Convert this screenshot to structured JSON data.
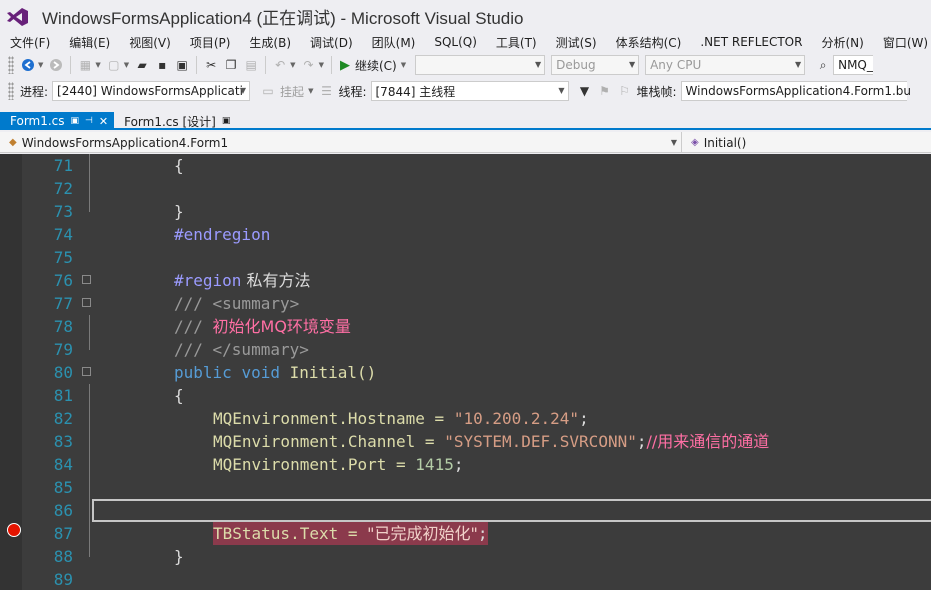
{
  "window": {
    "title": "WindowsFormsApplication4 (正在调试) - Microsoft Visual Studio"
  },
  "menu": [
    "文件(F)",
    "编辑(E)",
    "视图(V)",
    "项目(P)",
    "生成(B)",
    "调试(D)",
    "团队(M)",
    "SQL(Q)",
    "工具(T)",
    "测试(S)",
    "体系结构(C)",
    ".NET REFLECTOR",
    "分析(N)",
    "窗口(W)"
  ],
  "toolbar": {
    "continue_label": "继续(C)",
    "config": "Debug",
    "platform": "Any CPU",
    "find_value": "NMQ_"
  },
  "debug_toolbar": {
    "process_label": "进程:",
    "process_value": "[2440] WindowsFormsApplicati",
    "suspend_label": "挂起",
    "thread_label": "线程:",
    "thread_value": "[7844] 主线程",
    "stack_label": "堆栈帧:",
    "stack_value": "WindowsFormsApplication4.Form1.bu"
  },
  "tabs": [
    {
      "label": "Form1.cs",
      "active": true
    },
    {
      "label": "Form1.cs [设计]",
      "active": false
    }
  ],
  "navbar": {
    "type_value": "WindowsFormsApplication4.Form1",
    "member_value": "Initial()"
  },
  "code": {
    "line_numbers": [
      "71",
      "72",
      "73",
      "74",
      "75",
      "76",
      "77",
      "78",
      "79",
      "80",
      "81",
      "82",
      "83",
      "84",
      "85",
      "86",
      "87",
      "88",
      "89"
    ],
    "l71": "{",
    "l73": "}",
    "l74": "#endregion",
    "l76_kw": "#region",
    "l76_text": " 私有方法",
    "l77": "/// <summary>",
    "l78_prefix": "/// ",
    "l78_text": "初始化MQ环境变量",
    "l79": "/// </summary>",
    "l80_kw1": "public",
    "l80_kw2": "void",
    "l80_rest": " Initial()",
    "l81": "{",
    "l82_a": "MQEnvironment.Hostname = ",
    "l82_str": "\"10.200.2.24\"",
    "l82_end": ";",
    "l83_a": "MQEnvironment.Channel = ",
    "l83_str": "\"SYSTEM.DEF.SVRCONN\"",
    "l83_end": ";",
    "l83_comment": "//用来通信的通道",
    "l84_a": "MQEnvironment.Port = ",
    "l84_num": "1415",
    "l84_end": ";",
    "l87_a": "TBStatus.Text = ",
    "l87_str": "\"已完成初始化\"",
    "l87_end": ";",
    "l88": "}"
  },
  "colors": {
    "accent": "#007acc",
    "breakpoint": "#e51400",
    "breakpoint_highlight": "#8b3a4c"
  }
}
